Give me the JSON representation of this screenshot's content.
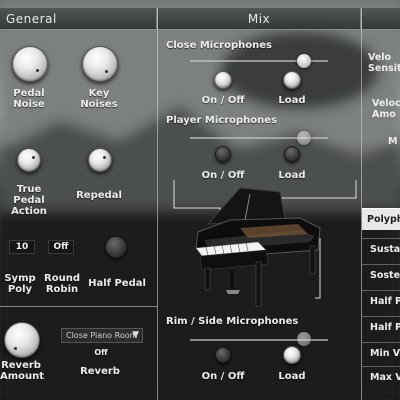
{
  "general": {
    "title": "General",
    "knobs": {
      "pedal_noise": "Pedal\nNoise",
      "key_noises": "Key\nNoises",
      "true_pedal_action": "True Pedal\nAction",
      "repedal": "Repedal",
      "half_pedal": "Half Pedal",
      "reverb_amount": "Reverb\nAmount"
    },
    "symp_poly": {
      "label": "Symp\nPoly",
      "value": "10"
    },
    "round_robin": {
      "label": "Round\nRobin",
      "value": "Off"
    },
    "reverb": {
      "label": "Reverb",
      "preset": "Close Piano Room",
      "state": "Off"
    }
  },
  "mix": {
    "title": "Mix",
    "sections": [
      {
        "name": "Close Microphones",
        "on_off": "On / Off",
        "load": "Load"
      },
      {
        "name": "Player Microphones",
        "on_off": "On / Off",
        "load": "Load"
      },
      {
        "name": "Rim / Side Microphones",
        "on_off": "On / Off",
        "load": "Load"
      }
    ]
  },
  "right": {
    "velocity_sensitivity": "Velo\nSensit",
    "velocity_amount": "Veloc\nAmo",
    "m_label": "M",
    "polyphony_tab": "Polyph",
    "rows": [
      "Sustai",
      "Sosten",
      "Half P",
      "Half P",
      "Min Ve",
      "Max Ve"
    ]
  },
  "icons": {
    "dropdown_arrow": "triangle-down"
  }
}
